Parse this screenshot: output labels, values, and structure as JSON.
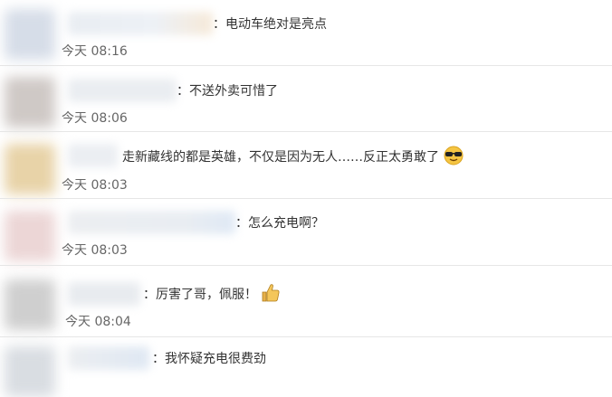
{
  "comments": [
    {
      "text": "：电动车绝对是亮点",
      "time": "今天 08:16"
    },
    {
      "text": "：不送外卖可惜了",
      "time": "今天 08:06"
    },
    {
      "text": "走新藏线的都是英雄，不仅是因为无人……反正太勇敢了",
      "time": "今天 08:03",
      "emoji": "cool-face-sunglasses"
    },
    {
      "text": "：怎么充电啊？",
      "time": "今天 08:03"
    },
    {
      "text": "：厉害了哥，佩服！",
      "time": "今天 08:04",
      "emoji": "thumbs-up"
    },
    {
      "text": "：我怀疑充电很费劲",
      "time": ""
    }
  ],
  "colors": {
    "text": "#333333",
    "time": "#666666",
    "divider": "#e6e6e6"
  }
}
